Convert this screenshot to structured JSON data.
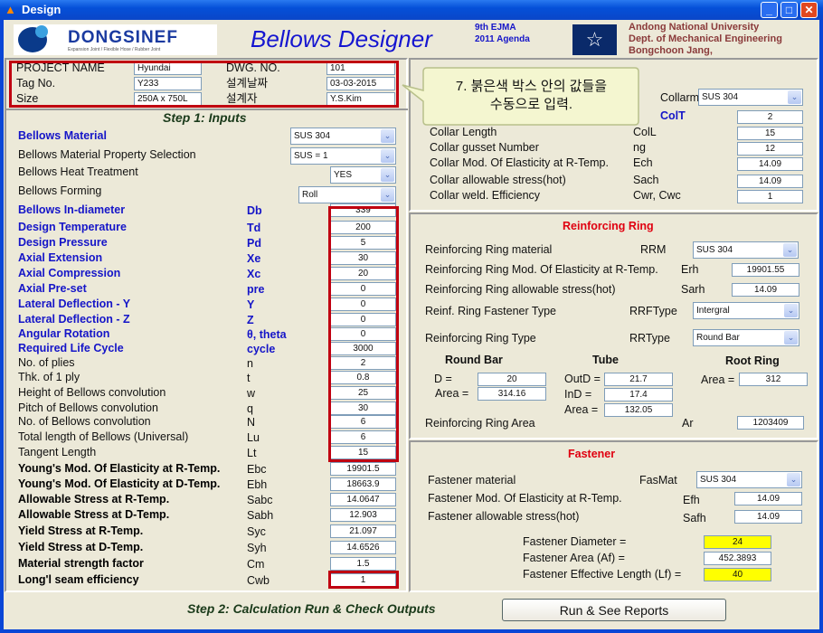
{
  "window": {
    "title": "Design",
    "icon": "matlab-icon",
    "controls": [
      "minimize-icon",
      "maximize-icon",
      "close-icon"
    ]
  },
  "header": {
    "logo_text": "DONGSINEF",
    "logo_sub": "Expansion Joint / Flexible Hose / Rubber Joint",
    "title": "Bellows  Designer",
    "agenda1": "9th EJMA",
    "agenda2": "2011 Agenda",
    "univ1": "Andong National University",
    "univ2": "Dept. of Mechanical Engineering",
    "univ3": "Bongchoon Jang,"
  },
  "project": {
    "rows": [
      {
        "label": "PROJECT NAME",
        "value": "Hyundai",
        "label2": "DWG. NO.",
        "value2": "101"
      },
      {
        "label": "Tag No.",
        "value": "Y233",
        "label2": "설계날짜",
        "value2": "03-03-2015"
      },
      {
        "label": "Size",
        "value": "250A x 750L",
        "label2": "설계자",
        "value2": "Y.S.Kim"
      }
    ]
  },
  "callout": {
    "line1": "7. 붉은색 박스 안의 값들을",
    "line2": "수동으로 입력."
  },
  "step1": {
    "title": "Step 1: Inputs",
    "selects": [
      {
        "label": "Bellows  Material",
        "value": "SUS 304"
      },
      {
        "label": "Bellows  Material Property Selection",
        "value": "SUS = 1"
      },
      {
        "label": "Bellows  Heat Treatment",
        "value": "YES"
      },
      {
        "label": "Bellows  Forming",
        "value": "Roll"
      }
    ],
    "rows": [
      {
        "label": "Bellows  In-diameter",
        "symbol": "Db",
        "value": "339"
      },
      {
        "label": "Design Temperature",
        "symbol": "Td",
        "value": "200"
      },
      {
        "label": "Design Pressure",
        "symbol": "Pd",
        "value": "5"
      },
      {
        "label": "Axial Extension",
        "symbol": "Xe",
        "value": "30"
      },
      {
        "label": "Axial Compression",
        "symbol": "Xc",
        "value": "20"
      },
      {
        "label": "Axial Pre-set",
        "symbol": "pre",
        "value": "0"
      },
      {
        "label": "Lateral Deflection - Y",
        "symbol": "Y",
        "value": "0"
      },
      {
        "label": "Lateral Deflection - Z",
        "symbol": "Z",
        "value": "0"
      },
      {
        "label": "Angular Rotation",
        "symbol": "θ, theta",
        "value": "0"
      },
      {
        "label": "Required Life Cycle",
        "symbol": "cycle",
        "value": "3000"
      },
      {
        "label": "No. of plies",
        "symbol": "n",
        "value": "2"
      },
      {
        "label": "Thk. of 1 ply",
        "symbol": "t",
        "value": "0.8"
      },
      {
        "label": "Height of Bellows convolution",
        "symbol": "w",
        "value": "25"
      },
      {
        "label": "Pitch of Bellows convolution",
        "symbol": "q",
        "value": "30"
      },
      {
        "label": "No. of Bellows convolution",
        "symbol": "N",
        "value": "6"
      },
      {
        "label": "Total length of Bellows (Universal)",
        "symbol": "Lu",
        "value": "6"
      },
      {
        "label": "Tangent Length",
        "symbol": "Lt",
        "value": "15"
      },
      {
        "label": "Young's Mod. Of Elasticity at R-Temp.",
        "symbol": "Ebc",
        "value": "19901.5"
      },
      {
        "label": "Young's Mod. Of Elasticity at D-Temp.",
        "symbol": "Ebh",
        "value": "18663.9"
      },
      {
        "label": "Allowable Stress at R-Temp.",
        "symbol": "Sabc",
        "value": "14.0647"
      },
      {
        "label": "Allowable Stress at D-Temp.",
        "symbol": "Sabh",
        "value": "12.903"
      },
      {
        "label": "Yield Stress at R-Temp.",
        "symbol": "Syc",
        "value": "21.097"
      },
      {
        "label": "Yield Stress at D-Temp.",
        "symbol": "Syh",
        "value": "14.6526"
      },
      {
        "label": "Material strength factor",
        "symbol": "Cm",
        "value": "1.5"
      },
      {
        "label": "Long'l seam efficiency",
        "symbol": "Cwb",
        "value": "1"
      }
    ]
  },
  "collar": {
    "material_symbol": "Collarm",
    "material_value": "SUS 304",
    "thk_symbol": "ColT",
    "thk_value": "2",
    "rows": [
      {
        "label": "Collar Length",
        "symbol": "ColL",
        "value": "15"
      },
      {
        "label": "Collar gusset Number",
        "symbol": "ng",
        "value": "12"
      },
      {
        "label": "Collar Mod. Of Elasticity at R-Temp.",
        "symbol": "Ech",
        "value": "14.09"
      },
      {
        "label": "Collar allowable stress(hot)",
        "symbol": "Sach",
        "value": "14.09"
      },
      {
        "label": "Collar weld. Efficiency",
        "symbol": "Cwr, Cwc",
        "value": "1"
      }
    ]
  },
  "ring": {
    "title": "Reinforcing Ring",
    "material": {
      "label": "Reinforcing Ring  material",
      "symbol": "RRM",
      "value": "SUS 304"
    },
    "modulus": {
      "label": "Reinforcing Ring Mod. Of Elasticity at R-Temp.",
      "symbol": "Erh",
      "value": "19901.55"
    },
    "stress": {
      "label": "Reinforcing Ring allowable stress(hot)",
      "symbol": "Sarh",
      "value": "14.09"
    },
    "fastener_type": {
      "label": "Reinf. Ring Fastener  Type",
      "symbol": "RRFType",
      "value": "Intergral"
    },
    "type": {
      "label": "Reinforcing Ring  Type",
      "symbol": "RRType",
      "value": "Round Bar"
    },
    "round_bar": {
      "title": "Round Bar",
      "d_label": "D =",
      "d": "20",
      "area_label": "Area =",
      "area": "314.16"
    },
    "tube": {
      "title": "Tube",
      "outd_label": "OutD =",
      "outd": "21.7",
      "ind_label": "InD =",
      "ind": "17.4",
      "area_label": "Area =",
      "area": "132.05"
    },
    "root_ring": {
      "title": "Root Ring",
      "area_label": "Area =",
      "area": "312"
    },
    "total": {
      "label": "Reinforcing Ring Area",
      "symbol": "Ar",
      "value": "1203409"
    }
  },
  "fastener": {
    "title": "Fastener",
    "material": {
      "label": "Fastener  material",
      "symbol": "FasMat",
      "value": "SUS 304"
    },
    "modulus": {
      "label": "Fastener Mod. Of Elasticity at R-Temp.",
      "symbol": "Efh",
      "value": "14.09"
    },
    "stress": {
      "label": "Fastener allowable stress(hot)",
      "symbol": "Safh",
      "value": "14.09"
    },
    "diameter": {
      "label": "Fastener Diameter =",
      "value": "24"
    },
    "area": {
      "label": "Fastener Area (Af) =",
      "value": "452.3893"
    },
    "length": {
      "label": "Fastener Effective Length (Lf) =",
      "value": "40"
    }
  },
  "step2": {
    "title": "Step 2: Calculation Run & Check Outputs",
    "run_button": "Run & See Reports"
  },
  "colors": {
    "required_box": "#c00010",
    "highlight": "#ffff00",
    "label_blue": "#1515c8",
    "section_red": "#e00010"
  }
}
